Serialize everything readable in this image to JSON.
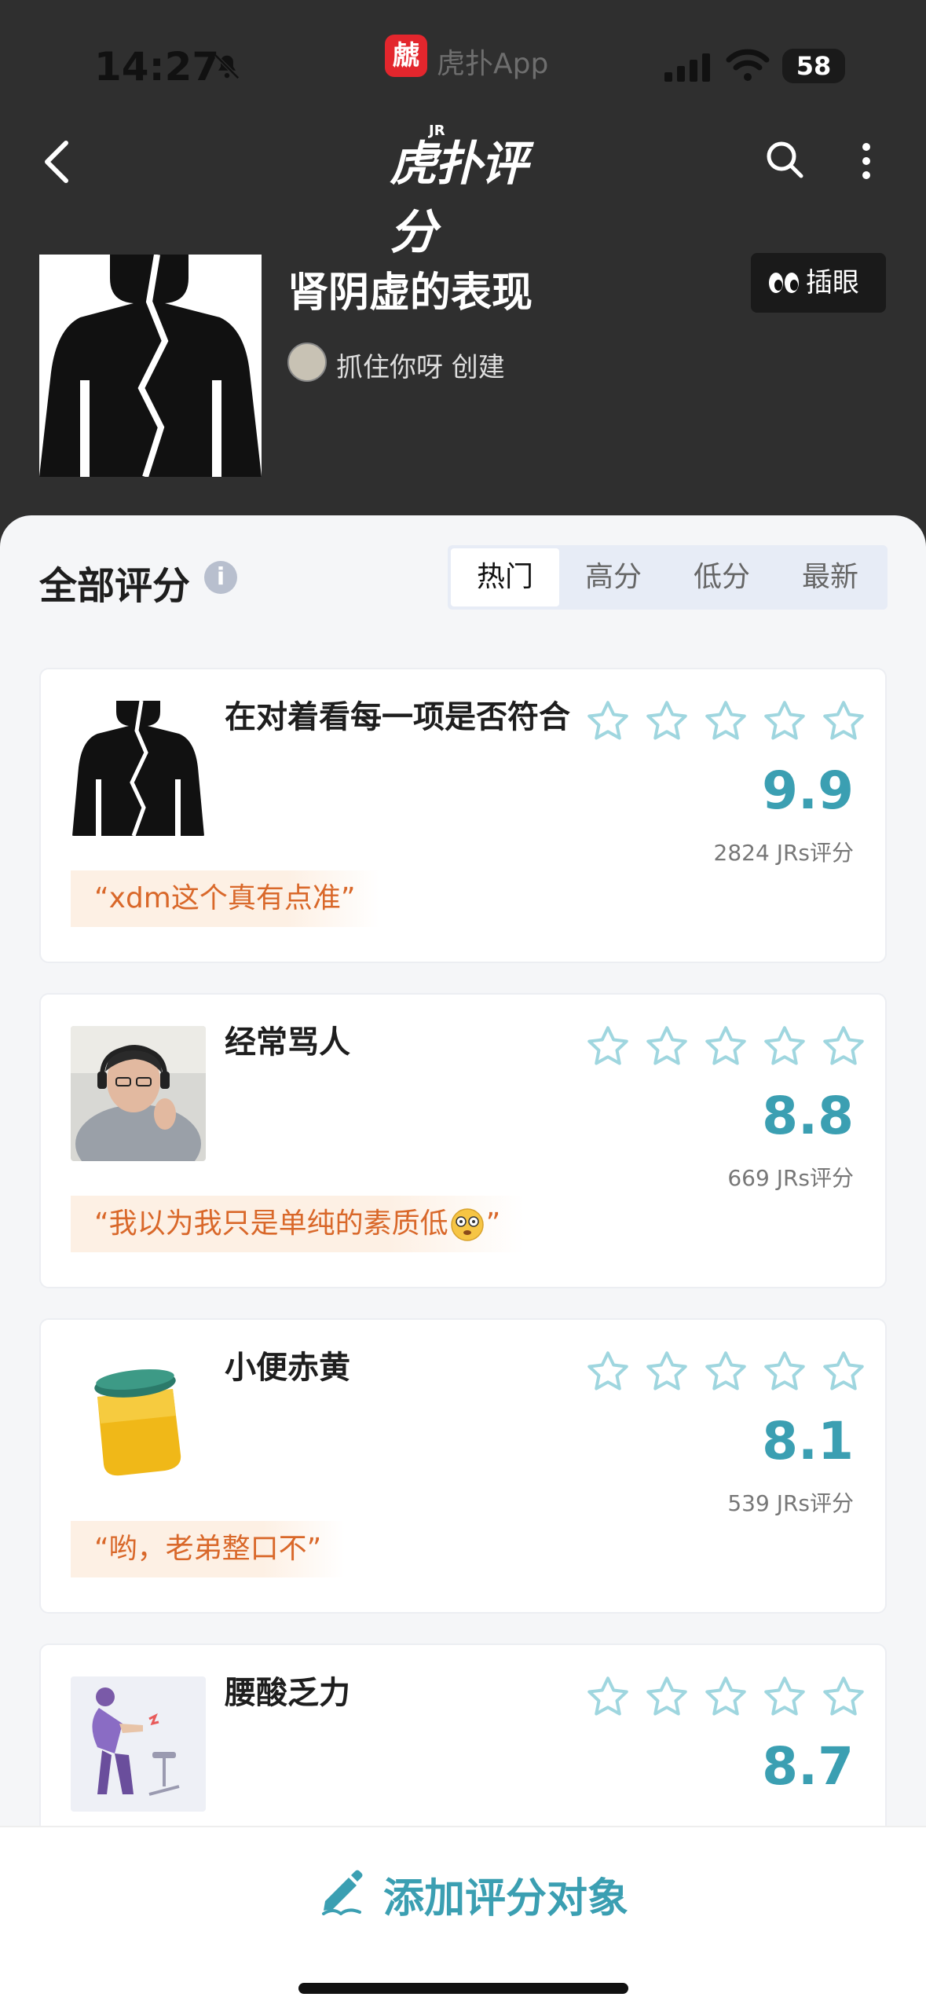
{
  "status_bar": {
    "time": "14:27",
    "app_name": "虎扑App",
    "app_badge": "虤",
    "battery": "58"
  },
  "nav": {
    "logo_text": "虎扑评分",
    "logo_superscript": "JR",
    "icons": [
      "back-icon",
      "search-icon",
      "more-icon"
    ]
  },
  "header": {
    "title": "肾阴虚的表现",
    "creator": "抓住你呀 创建",
    "peek_label": "插眼"
  },
  "list": {
    "title": "全部评分",
    "tabs": [
      "热门",
      "高分",
      "低分",
      "最新"
    ],
    "active_tab": "热门",
    "items": [
      {
        "name": "在对着看每一项是否符合",
        "score": "9.9",
        "count": "2824 JRs评分",
        "quote": "“xdm这个真有点准”",
        "stars_filled": 0
      },
      {
        "name": "经常骂人",
        "score": "8.8",
        "count": "669 JRs评分",
        "quote": "“我以为我只是单纯的素质低",
        "quote_end": "”",
        "stars_filled": 0
      },
      {
        "name": "小便赤黄",
        "score": "8.1",
        "count": "539 JRs评分",
        "quote": "“哟，老弟整口不”",
        "stars_filled": 0
      },
      {
        "name": "腰酸乏力",
        "score": "8.7",
        "stars_filled": 0
      }
    ]
  },
  "bottom": {
    "add_label": "添加评分对象"
  },
  "colors": {
    "accent": "#3b9fb2",
    "quote_text": "#d9682a",
    "quote_bg": "#fdf0e4",
    "header_bg": "#2f2f2f",
    "brand_red": "#e3262d"
  }
}
